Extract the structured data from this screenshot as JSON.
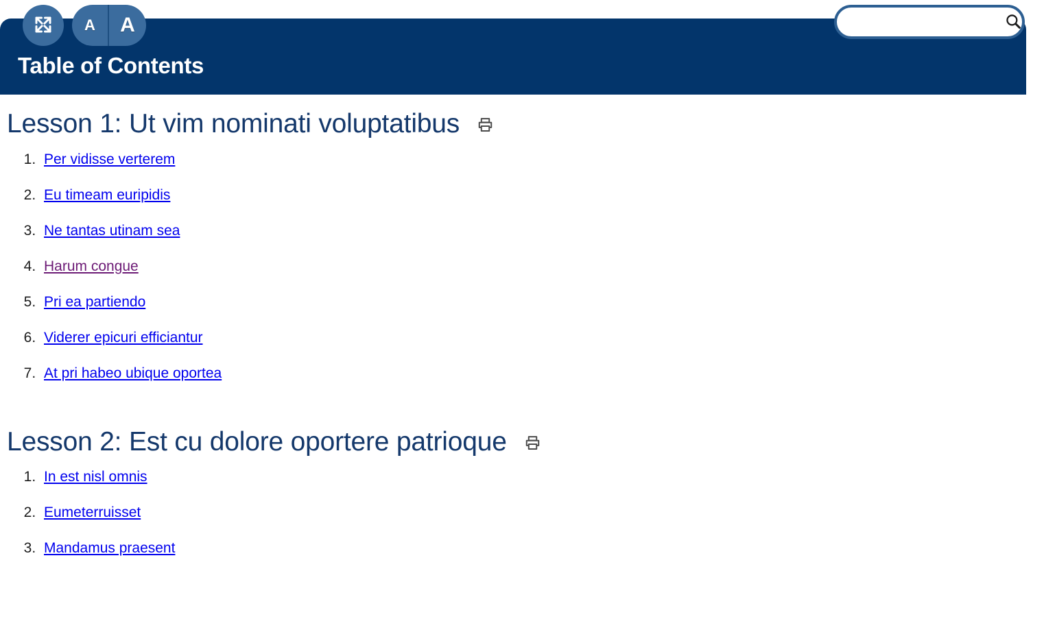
{
  "header": {
    "title": "Table of Contents",
    "background_color": "#03356b",
    "toolbar": {
      "fullscreen": {
        "icon": "fullscreen-expand-icon",
        "label": ""
      },
      "text_smaller": {
        "icon": "letter-a-small-icon",
        "label": "A"
      },
      "text_larger": {
        "icon": "letter-a-large-icon",
        "label": "A"
      }
    },
    "search": {
      "value": "",
      "placeholder": "",
      "icon": "magnifier-icon",
      "border_color": "#2d5f92"
    }
  },
  "content": {
    "heading_color": "#14386b",
    "link_color": "#0000ee",
    "visited_link_color": "#6c1a75",
    "lessons": [
      {
        "title": "Lesson 1: Ut vim nominati voluptatibus",
        "print_icon": "printer-icon",
        "items": [
          {
            "label": "Per vidisse verterem",
            "visited": false
          },
          {
            "label": "Eu timeam euripidis",
            "visited": false
          },
          {
            "label": "Ne tantas utinam sea",
            "visited": false
          },
          {
            "label": "Harum congue",
            "visited": true
          },
          {
            "label": "Pri ea partiendo",
            "visited": false
          },
          {
            "label": "Viderer epicuri efficiantur",
            "visited": false
          },
          {
            "label": "At pri habeo ubique oportea",
            "visited": false
          }
        ]
      },
      {
        "title": "Lesson 2: Est cu dolore oportere patrioque",
        "print_icon": "printer-icon",
        "items": [
          {
            "label": "In est nisl omnis",
            "visited": false
          },
          {
            "label": "Eumeterruisset",
            "visited": false
          },
          {
            "label": "Mandamus praesent",
            "visited": false
          }
        ]
      }
    ]
  }
}
